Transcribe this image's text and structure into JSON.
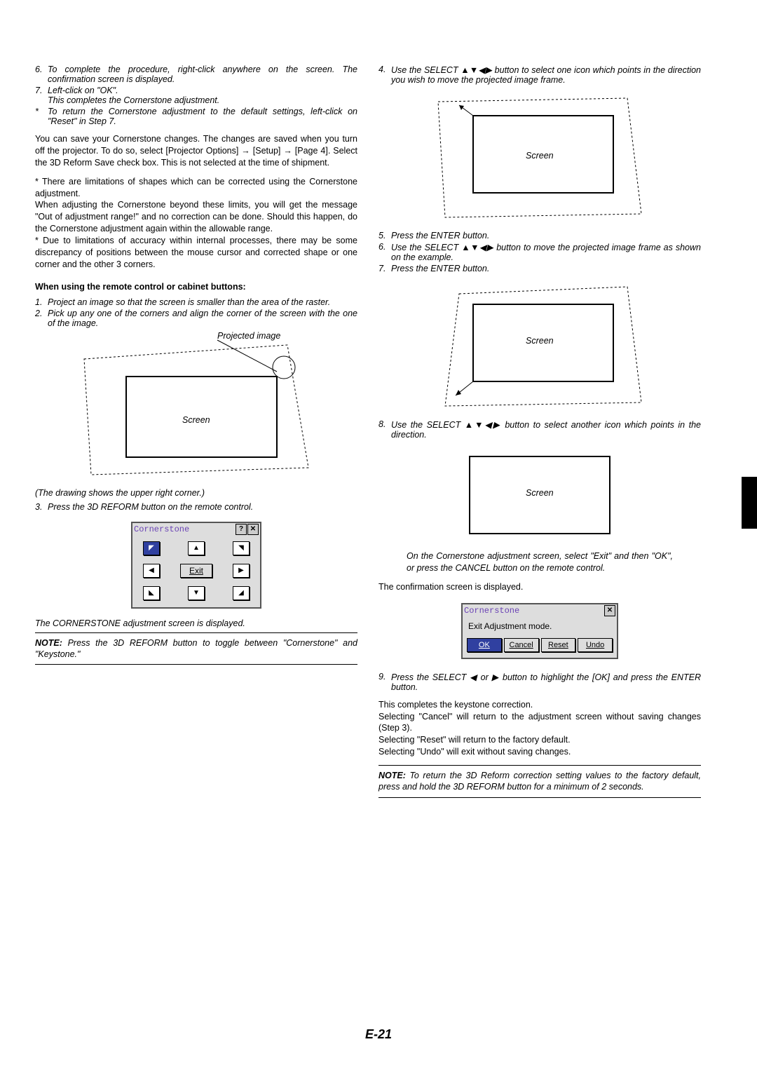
{
  "page_number": "E-21",
  "arrows_glyph": "▲▼◀▶",
  "left_col": {
    "step6": "To complete the procedure, right-click anywhere on the screen. The confirmation screen is displayed.",
    "step7a": "Left-click on \"OK\".",
    "step7b": "This completes the Cornerstone adjustment.",
    "step_star": "To return the Cornerstone adjustment to the default settings, left-click on \"Reset\" in Step 7.",
    "para_save": "You can save your Cornerstone changes. The changes are saved when you turn off the projector. To do so, select [Projector Options] → [Setup] → [Page 4]. Select the 3D Reform Save check box. This is not selected at the time of shipment.",
    "para_limits": "* There are limitations of shapes which can be corrected using the Cornerstone adjustment.\nWhen adjusting the Cornerstone beyond these limits, you will get the message \"Out of adjustment range!\" and no correction can be done. Should this happen, do the Cornerstone adjustment again within the allowable range.\n* Due to limitations of accuracy within internal processes, there may be some discrepancy of positions between the mouse cursor and corrected shape or one corner and the other 3 corners.",
    "remote_head": "When using the remote control or cabinet buttons:",
    "r_step1": "Project an image so that the screen is smaller than the area of the raster.",
    "r_step2": "Pick up any one of the corners and align the corner of the screen with the one of the image.",
    "fig1_proj": "Projected image",
    "fig1_screen": "Screen",
    "fig1_caption": "(The drawing shows the upper right corner.)",
    "r_step3": "Press the 3D REFORM button on the remote control.",
    "corner_title": "Cornerstone",
    "exit_btn": "Exit",
    "corner_caption": "The CORNERSTONE adjustment screen is displayed.",
    "note1": "Press the 3D REFORM button to toggle between \"Cornerstone\" and \"Keystone.\""
  },
  "right_col": {
    "r_step4": "Use the SELECT ▲▼◀▶ button to select one icon which points in the direction you wish to move the projected image frame.",
    "fig2_screen": "Screen",
    "r_step5": "Press the ENTER button.",
    "r_step6": "Use the SELECT ▲▼◀▶ button to move the projected image frame as shown on the example.",
    "r_step7": "Press the ENTER button.",
    "fig3_screen": "Screen",
    "r_step8": "Use the SELECT ▲▼◀▶ button to select another icon which points in the direction.",
    "fig4_screen": "Screen",
    "indent_caption": "On the Cornerstone adjustment screen, select \"Exit\" and then \"OK\", or press the CANCEL button on the remote control.",
    "confirm_line": "The confirmation screen is displayed.",
    "exit_title": "Cornerstone",
    "exit_msg": "Exit Adjustment mode.",
    "btn_ok": "OK",
    "btn_cancel": "Cancel",
    "btn_reset": "Reset",
    "btn_undo": "Undo",
    "r_step9": "Press the SELECT ◀ or ▶ button to highlight the [OK] and press the ENTER button.",
    "para_complete": "This completes the keystone correction.\nSelecting \"Cancel\" will return to the adjustment screen without saving changes (Step 3).\nSelecting \"Reset\" will return to the factory default.\nSelecting \"Undo\" will exit without saving changes.",
    "note2": "To return the 3D Reform correction setting values to the factory default, press and hold the 3D REFORM button for a minimum of 2 seconds."
  }
}
